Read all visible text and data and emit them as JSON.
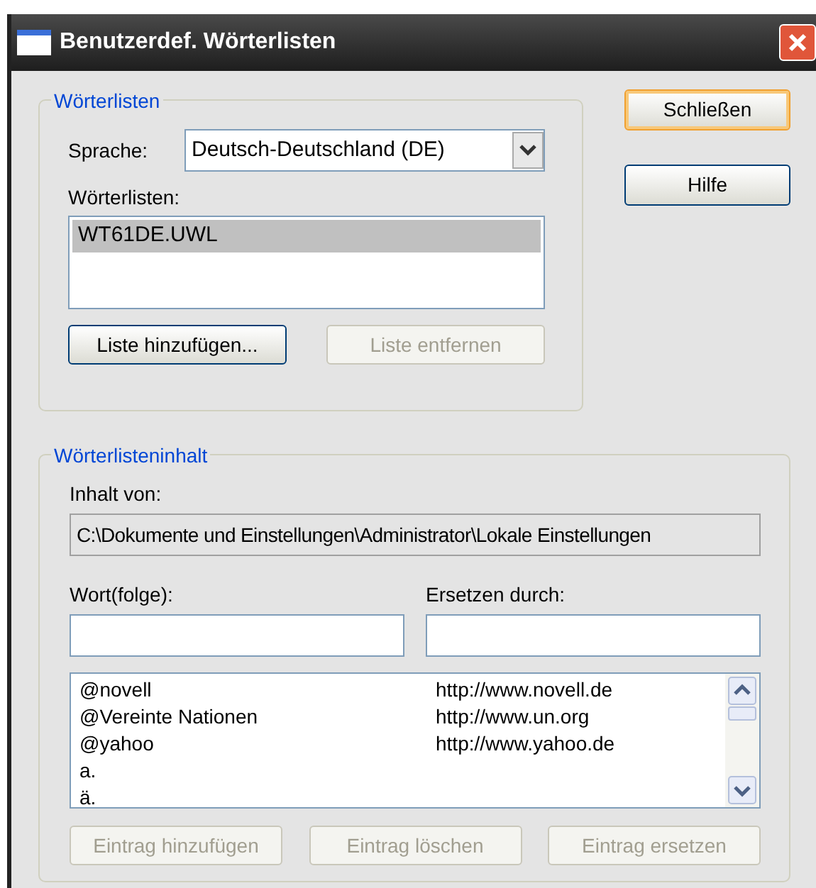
{
  "window": {
    "title": "Benutzerdef. Wörterlisten"
  },
  "side_buttons": [
    {
      "label": "Schließen",
      "default": true
    },
    {
      "label": "Hilfe",
      "default": false
    }
  ],
  "wordlists_group": {
    "title": "Wörterlisten",
    "language_label": "Sprache:",
    "language": "Deutsch-Deutschland (DE)",
    "lists_label": "Wörterlisten:",
    "lists": [
      {
        "name": "WT61DE.UWL",
        "selected": true
      }
    ],
    "buttons": [
      {
        "label": "Liste hinzufügen...",
        "disabled": false
      },
      {
        "label": "Liste entfernen",
        "disabled": true
      }
    ]
  },
  "content_group": {
    "title": "Wörterlisteninhalt",
    "source_label": "Inhalt von:",
    "source": "C:\\Dokumente und Einstellungen\\Administrator\\Lokale Einstellungen",
    "word_label": "Wort(folge):",
    "replace_label": "Ersetzen durch:",
    "entries": [
      {
        "word": "@novell",
        "replacement": "http://www.novell.de"
      },
      {
        "word": "@Vereinte Nationen",
        "replacement": "http://www.un.org"
      },
      {
        "word": "@yahoo",
        "replacement": "http://www.yahoo.de"
      },
      {
        "word": "a."
      },
      {
        "word": "ä."
      }
    ],
    "buttons": [
      {
        "label": "Eintrag hinzufügen",
        "disabled": true
      },
      {
        "label": "Eintrag löschen",
        "disabled": true
      },
      {
        "label": "Eintrag ersetzen",
        "disabled": true
      }
    ]
  }
}
